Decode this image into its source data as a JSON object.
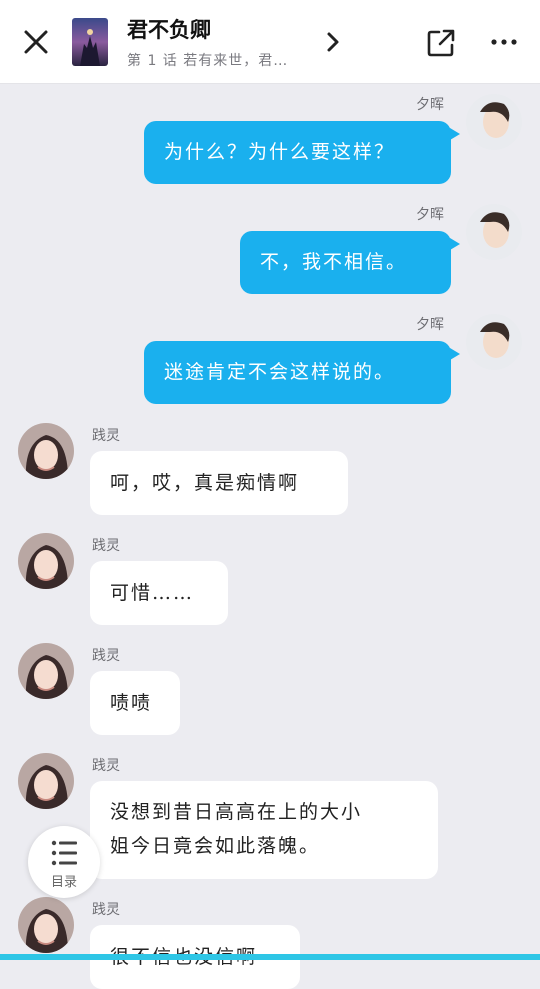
{
  "header": {
    "title": "君不负卿",
    "subtitle": "第 1 话 若有来世，君…"
  },
  "messages": [
    {
      "side": "right",
      "name": "夕晖",
      "text": "为什么？为什么要这样？"
    },
    {
      "side": "right",
      "name": "夕晖",
      "text": "不，我不相信。"
    },
    {
      "side": "right",
      "name": "夕晖",
      "text": "迷途肯定不会这样说的。"
    },
    {
      "side": "left",
      "name": "践灵",
      "text": "呵，哎，真是痴情啊"
    },
    {
      "side": "left",
      "name": "践灵",
      "text": "可惜……"
    },
    {
      "side": "left",
      "name": "践灵",
      "text": "啧啧"
    },
    {
      "side": "left",
      "name": "践灵",
      "line1": "没想到昔日高高在上的大小",
      "line2": "姐今日竟会如此落魄。"
    },
    {
      "side": "left",
      "name": "践灵",
      "text": "很不信也没信啊"
    }
  ],
  "toc": {
    "label": "目录"
  },
  "colors": {
    "bubble_right": "#1ab0ee",
    "accent_bottom": "#2ec6e6"
  }
}
